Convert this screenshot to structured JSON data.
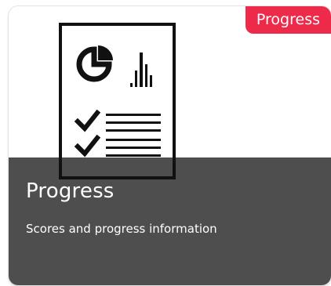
{
  "card": {
    "badge": "Progress",
    "title": "Progress",
    "description": "Scores and progress information",
    "icon": "report-document-icon",
    "colors": {
      "badge_bg": "#ee2a4b",
      "overlay_bg": "#484848",
      "icon_color": "#111111"
    }
  }
}
